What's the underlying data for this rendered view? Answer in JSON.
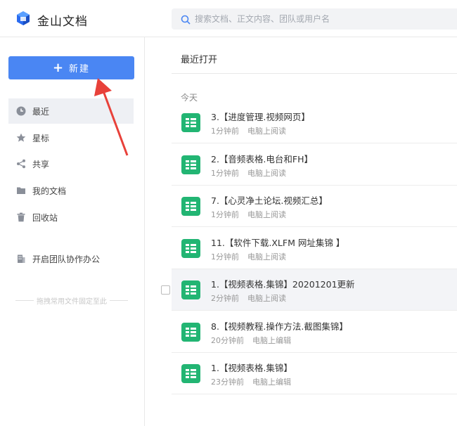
{
  "app": {
    "brand": "金山文档"
  },
  "search": {
    "placeholder": "搜索文档、正文内容、团队或用户名"
  },
  "sidebar": {
    "new_label": "新建",
    "items": [
      {
        "label": "最近",
        "icon": "clock-icon"
      },
      {
        "label": "星标",
        "icon": "star-icon"
      },
      {
        "label": "共享",
        "icon": "share-icon"
      },
      {
        "label": "我的文档",
        "icon": "folder-icon"
      },
      {
        "label": "回收站",
        "icon": "trash-icon"
      }
    ],
    "team_label": "开启团队协作办公",
    "pin_hint": "拖拽常用文件固定至此"
  },
  "main": {
    "section_title": "最近打开",
    "group_label": "今天",
    "files": [
      {
        "name": "3.【进度管理.视频网页】",
        "time": "1分钟前",
        "source": "电脑上阅读"
      },
      {
        "name": "2.【音频表格.电台和FH】",
        "time": "1分钟前",
        "source": "电脑上阅读"
      },
      {
        "name": "7.【心灵净土论坛.视频汇总】",
        "time": "1分钟前",
        "source": "电脑上阅读"
      },
      {
        "name": "11.【软件下载.XLFM 网址集锦 】",
        "time": "1分钟前",
        "source": "电脑上阅读"
      },
      {
        "name": "1.【视频表格.集锦】20201201更新",
        "time": "2分钟前",
        "source": "电脑上阅读"
      },
      {
        "name": "8.【视频教程.操作方法.截图集锦】",
        "time": "20分钟前",
        "source": "电脑上编辑"
      },
      {
        "name": "1.【视频表格.集锦】",
        "time": "23分钟前",
        "source": "电脑上编辑"
      }
    ]
  },
  "colors": {
    "accent": "#4a86f3",
    "sheet_icon": "#22b573",
    "annotation_arrow": "#e8413a"
  }
}
